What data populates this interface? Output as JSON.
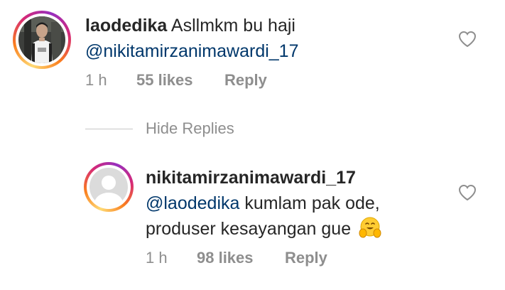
{
  "comment": {
    "username": "laodedika",
    "text": "Asllmkm bu haji",
    "mention": "@nikitamirzanimawardi_17",
    "time": "1 h",
    "likes": "55 likes",
    "reply_label": "Reply",
    "icons": {
      "like": "heart-outline-icon"
    }
  },
  "hide_replies_label": "Hide Replies",
  "reply": {
    "username": "nikitamirzanimawardi_17",
    "mention": "@laodedika",
    "text_line1": "kumlam pak ode,",
    "text_line2": "produser kesayangan gue",
    "emoji": "hugging-face-emoji",
    "time": "1 h",
    "likes": "98 likes",
    "reply_label": "Reply",
    "icons": {
      "like": "heart-outline-icon"
    }
  },
  "colors": {
    "text": "#262626",
    "mention": "#00376b",
    "meta": "#8e8e8e",
    "divider": "#c7c7c7",
    "story_ring": [
      "#feda75",
      "#fa7e1e",
      "#d62976",
      "#962fbf"
    ]
  }
}
